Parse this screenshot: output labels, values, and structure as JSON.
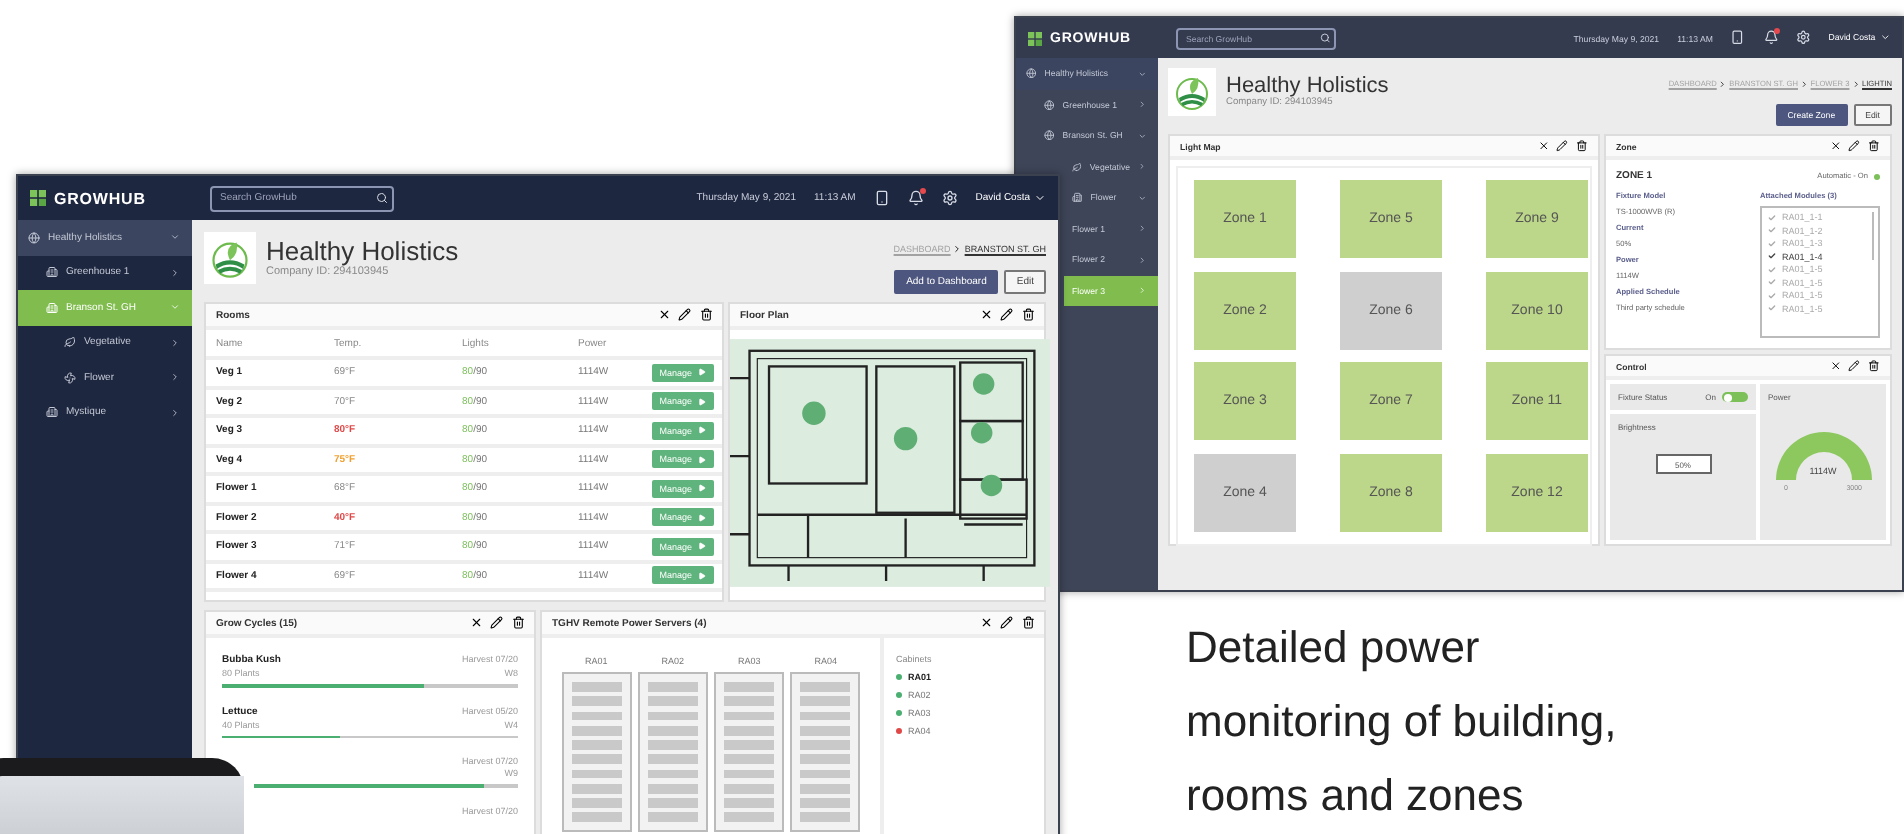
{
  "back_app": {
    "brand": "GROWHUB",
    "search": {
      "placeholder": "Search GrowHub"
    },
    "date": "Thursday May 9, 2021",
    "time": "11:13 AM",
    "notifications": {
      "unread": true
    },
    "user": "David Costa",
    "sidebar": {
      "items": [
        {
          "label": "Healthy Holistics",
          "kind": "globe",
          "selected": false,
          "expanded": true,
          "children": [
            {
              "label": "Greenhouse 1",
              "kind": "globe",
              "selected": false,
              "expanded": false
            },
            {
              "label": "Branson St. GH",
              "kind": "globe",
              "selected": false,
              "expanded": true,
              "children": [
                {
                  "label": "Vegetative",
                  "kind": "leaf",
                  "selected": false,
                  "expanded": false
                },
                {
                  "label": "Flower",
                  "kind": "building",
                  "selected": false,
                  "expanded": true,
                  "children": [
                    {
                      "label": "Flower 1",
                      "selected": false,
                      "expanded": false
                    },
                    {
                      "label": "Flower 2",
                      "selected": false,
                      "expanded": false
                    },
                    {
                      "label": "Flower 3",
                      "selected": true,
                      "expanded": false
                    }
                  ]
                }
              ]
            }
          ]
        }
      ]
    },
    "company": {
      "name": "Healthy Holistics",
      "id_label": "Company ID: 294103945"
    },
    "breadcrumb": [
      {
        "label": "DASHBOARD",
        "current": false
      },
      {
        "label": "BRANSTON ST. GH",
        "current": false
      },
      {
        "label": "FLOWER 3",
        "current": false
      },
      {
        "label": "LIGHTIN",
        "current": true
      }
    ],
    "actions": [
      {
        "label": "Create Zone",
        "kind": "primary"
      },
      {
        "label": "Edit",
        "kind": "secondary"
      }
    ],
    "light_map": {
      "title": "Light Map",
      "zones": [
        {
          "label": "Zone 1",
          "active": true
        },
        {
          "label": "Zone 5",
          "active": true
        },
        {
          "label": "Zone 9",
          "active": true
        },
        {
          "label": "Zone 2",
          "active": true
        },
        {
          "label": "Zone 6",
          "active": false
        },
        {
          "label": "Zone 10",
          "active": true
        },
        {
          "label": "Zone 3",
          "active": true
        },
        {
          "label": "Zone 7",
          "active": true
        },
        {
          "label": "Zone 11",
          "active": true
        },
        {
          "label": "Zone 4",
          "active": false
        },
        {
          "label": "Zone 8",
          "active": true
        },
        {
          "label": "Zone 12",
          "active": true
        }
      ]
    },
    "zone": {
      "title": "Zone",
      "name": "ZONE 1",
      "mode": "Automatic - On",
      "mode_on": true,
      "fields": [
        {
          "label": "Fixture Model",
          "value": "TS-1000WVB (R)"
        },
        {
          "label": "Current",
          "value": "50%"
        },
        {
          "label": "Power",
          "value": "1114W"
        },
        {
          "label": "Applied Schedule",
          "value": "Third party schedule"
        }
      ],
      "modules_title": "Attached Modules (3)",
      "modules": [
        {
          "label": "RA01_1-1",
          "checked": true,
          "selected": false
        },
        {
          "label": "RA01_1-2",
          "checked": true,
          "selected": false
        },
        {
          "label": "RA01_1-3",
          "checked": true,
          "selected": false
        },
        {
          "label": "RA01_1-4",
          "checked": true,
          "selected": true
        },
        {
          "label": "RA01_1-5",
          "checked": true,
          "selected": false
        },
        {
          "label": "RA01_1-5",
          "checked": true,
          "selected": false
        },
        {
          "label": "RA01_1-5",
          "checked": true,
          "selected": false
        },
        {
          "label": "RA01_1-5",
          "checked": true,
          "selected": false
        }
      ]
    },
    "control": {
      "title": "Control",
      "fixture_status": {
        "label": "Fixture Status",
        "state": "On",
        "on": true
      },
      "brightness": {
        "label": "Brightness",
        "value": "50%"
      },
      "power": {
        "label": "Power",
        "reading": "1114W",
        "min": "0",
        "max": "3000"
      }
    }
  },
  "front_app": {
    "brand": "GROWHUB",
    "search": {
      "placeholder": "Search GrowHub"
    },
    "date": "Thursday May 9, 2021",
    "time": "11:13 AM",
    "notifications": {
      "unread": true
    },
    "user": "David Costa",
    "sidebar": {
      "items": [
        {
          "label": "Healthy Holistics",
          "kind": "globe",
          "selected": false,
          "expanded": true,
          "children": [
            {
              "label": "Greenhouse 1",
              "kind": "building",
              "selected": false,
              "expanded": false
            },
            {
              "label": "Branson St. GH",
              "kind": "building",
              "selected": true,
              "expanded": true,
              "children": [
                {
                  "label": "Vegetative",
                  "kind": "leaf",
                  "selected": false,
                  "expanded": false
                },
                {
                  "label": "Flower",
                  "kind": "fan",
                  "selected": false,
                  "expanded": false
                }
              ]
            },
            {
              "label": "Mystique",
              "kind": "building",
              "selected": false,
              "expanded": false
            }
          ]
        }
      ]
    },
    "company": {
      "name": "Healthy Holistics",
      "id_label": "Company ID: 294103945"
    },
    "breadcrumb": [
      {
        "label": "DASHBOARD",
        "current": false
      },
      {
        "label": "BRANSTON ST. GH",
        "current": true
      }
    ],
    "actions": [
      {
        "label": "Add to Dashboard",
        "kind": "primary"
      },
      {
        "label": "Edit",
        "kind": "secondary"
      }
    ],
    "rooms": {
      "title": "Rooms",
      "columns": [
        "Name",
        "Temp.",
        "Lights",
        "Power"
      ],
      "rows": [
        {
          "name": "Veg 1",
          "temp": "69°F",
          "kind": "normal",
          "lights_on": "80",
          "lights_total": "/90",
          "power": "1114W",
          "action": "Manage"
        },
        {
          "name": "Veg 2",
          "temp": "70°F",
          "kind": "normal",
          "lights_on": "80",
          "lights_total": "/90",
          "power": "1114W",
          "action": "Manage"
        },
        {
          "name": "Veg 3",
          "temp": "80°F",
          "kind": "alert",
          "lights_on": "80",
          "lights_total": "/90",
          "power": "1114W",
          "action": "Manage"
        },
        {
          "name": "Veg 4",
          "temp": "75°F",
          "kind": "warning",
          "lights_on": "80",
          "lights_total": "/90",
          "power": "1114W",
          "action": "Manage"
        },
        {
          "name": "Flower 1",
          "temp": "68°F",
          "kind": "normal",
          "lights_on": "80",
          "lights_total": "/90",
          "power": "1114W",
          "action": "Manage"
        },
        {
          "name": "Flower 2",
          "temp": "40°F",
          "kind": "alert",
          "lights_on": "80",
          "lights_total": "/90",
          "power": "1114W",
          "action": "Manage"
        },
        {
          "name": "Flower 3",
          "temp": "71°F",
          "kind": "normal",
          "lights_on": "80",
          "lights_total": "/90",
          "power": "1114W",
          "action": "Manage"
        },
        {
          "name": "Flower 4",
          "temp": "69°F",
          "kind": "normal",
          "lights_on": "80",
          "lights_total": "/90",
          "power": "1114W",
          "action": "Manage"
        }
      ]
    },
    "floor_plan": {
      "title": "Floor Plan"
    },
    "grow_cycles": {
      "title": "Grow Cycles (15)",
      "items": [
        {
          "name": "Bubba Kush",
          "plants": "80 Plants",
          "harvest": "Harvest 07/20",
          "week": "W8",
          "level": 0.68
        },
        {
          "name": "Lettuce",
          "plants": "40 Plants",
          "harvest": "Harvest 05/20",
          "week": "W4",
          "level": 0.4
        },
        {
          "harvest": "Harvest 07/20",
          "week": "W9",
          "level": 0.87
        },
        {
          "harvest": "Harvest 07/20"
        }
      ]
    },
    "servers": {
      "title": "TGHV Remote Power Servers (4)",
      "racks": [
        "RA01",
        "RA02",
        "RA03",
        "RA04"
      ],
      "cabinets_title": "Cabinets",
      "cabinets": [
        {
          "label": "RA01",
          "color": "#4caf72",
          "selected": true
        },
        {
          "label": "RA02",
          "color": "#4caf72",
          "selected": false
        },
        {
          "label": "RA03",
          "color": "#4caf72",
          "selected": false
        },
        {
          "label": "RA04",
          "color": "#e04848",
          "selected": false
        }
      ]
    }
  },
  "tagline": "Detailed power monitoring of building, rooms and zones"
}
